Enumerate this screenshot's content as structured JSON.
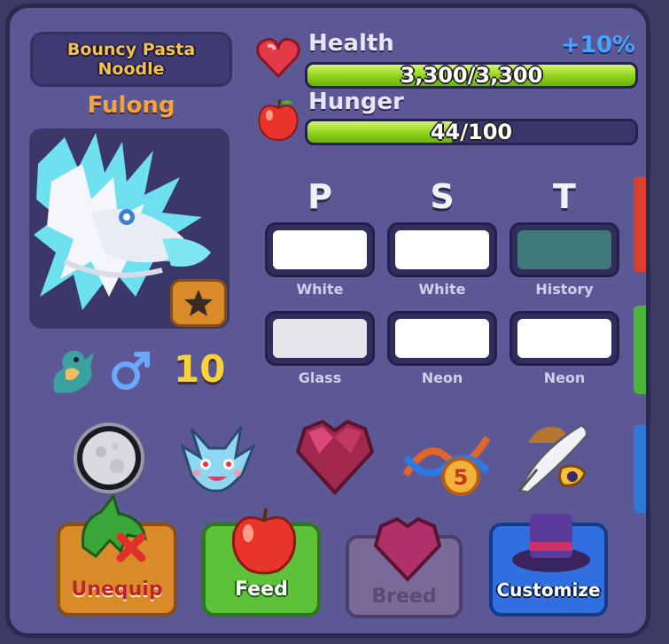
{
  "pet": {
    "name_line": "Bouncy Pasta\nNoodle",
    "species": "Fulong",
    "age": "10"
  },
  "stats": {
    "health_label": "Health",
    "health_value": "3,300/3,300",
    "health_fraction": 1.0,
    "health_bonus": "+10%",
    "hunger_label": "Hunger",
    "hunger_value": "44/100",
    "hunger_fraction": 0.44
  },
  "traits": {
    "headers": [
      "P",
      "S",
      "T"
    ],
    "row1": [
      {
        "label": "White",
        "color": "#ffffff"
      },
      {
        "label": "White",
        "color": "#ffffff"
      },
      {
        "label": "History",
        "color": "#3f7a78"
      }
    ],
    "row2": [
      {
        "label": "Glass",
        "color": "#e6e6ea"
      },
      {
        "label": "Neon",
        "color": "#ffffff"
      },
      {
        "label": "Neon",
        "color": "#ffffff"
      }
    ]
  },
  "accessories": {
    "icons": [
      "moon-orb-icon",
      "dragon-pet-face-icon",
      "heart-gem-icon",
      "dna-helix-icon",
      "quill-and-hat-icon"
    ],
    "dna_count": "5"
  },
  "actions": {
    "unequip": "Unequip",
    "feed": "Feed",
    "breed": "Breed",
    "customize": "Customize"
  },
  "colors": {
    "panel": "#5c5795",
    "health_bar": "#8fd21a",
    "unequip": "#d98b2a",
    "feed": "#5dc13a",
    "breed": "#7a6a9a",
    "customize": "#2f6fe0"
  }
}
